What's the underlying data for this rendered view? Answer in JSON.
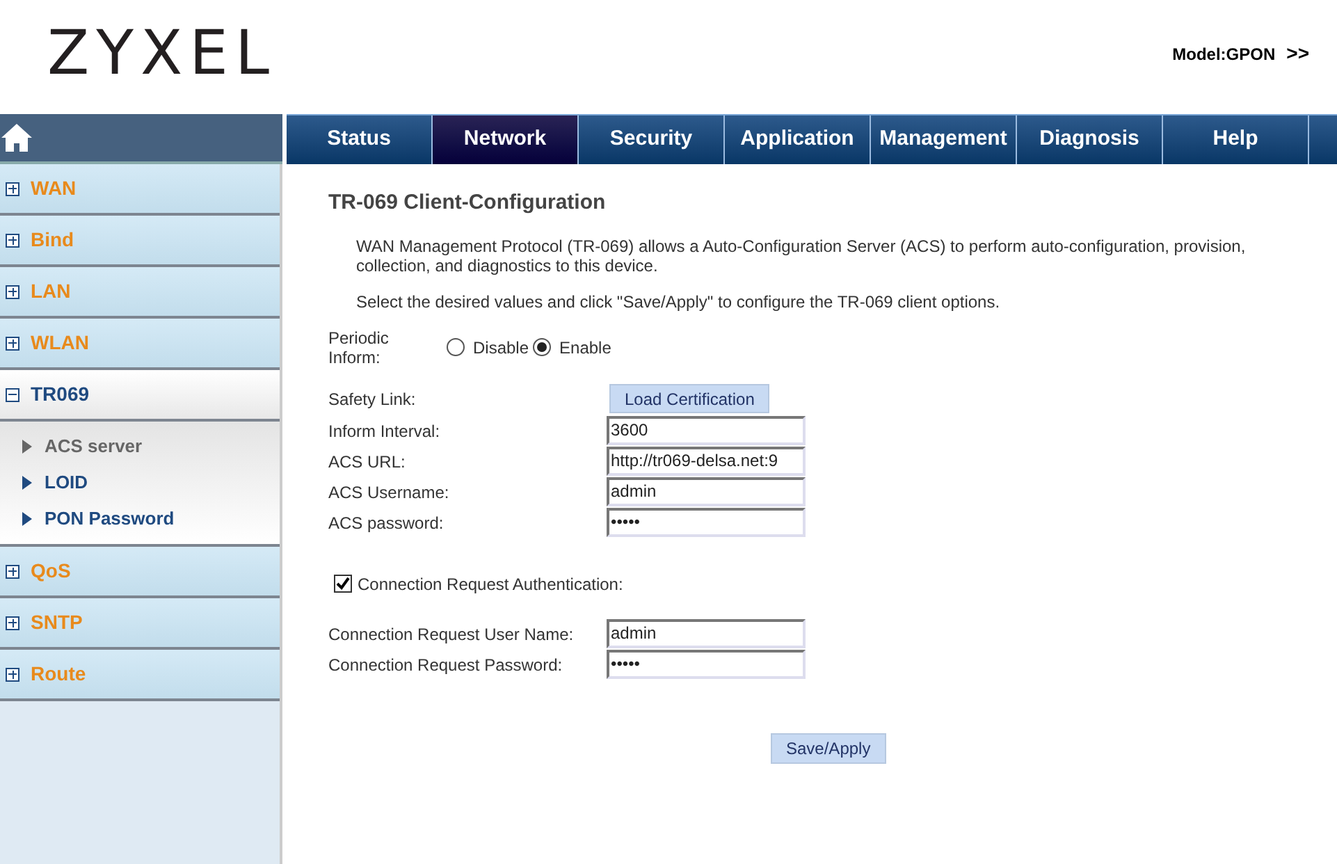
{
  "header": {
    "logo": "ZYXEL",
    "model": "Model:GPON",
    "next": ">>"
  },
  "nav_tabs": [
    {
      "label": "Status",
      "selected": false
    },
    {
      "label": "Network",
      "selected": true
    },
    {
      "label": "Security",
      "selected": false
    },
    {
      "label": "Application",
      "selected": false
    },
    {
      "label": "Management",
      "selected": false
    },
    {
      "label": "Diagnosis",
      "selected": false
    },
    {
      "label": "Help",
      "selected": false
    }
  ],
  "sidebar": {
    "items": [
      {
        "label": "WAN",
        "expanded": false
      },
      {
        "label": "Bind",
        "expanded": false
      },
      {
        "label": "LAN",
        "expanded": false
      },
      {
        "label": "WLAN",
        "expanded": false
      },
      {
        "label": "TR069",
        "expanded": true,
        "children": [
          {
            "label": "ACS server",
            "selected": true
          },
          {
            "label": "LOID",
            "selected": false
          },
          {
            "label": "PON Password",
            "selected": false
          }
        ]
      },
      {
        "label": "QoS",
        "expanded": false
      },
      {
        "label": "SNTP",
        "expanded": false
      },
      {
        "label": "Route",
        "expanded": false
      }
    ]
  },
  "page": {
    "title": "TR-069 Client-Configuration",
    "paragraphs": [
      "WAN Management Protocol (TR-069) allows a Auto-Configuration Server (ACS) to perform auto-configuration, provision, collection, and diagnostics to this device.",
      "Select the desired values and click \"Save/Apply\" to configure the TR-069 client options."
    ],
    "periodic_inform": {
      "label": "Periodic Inform:",
      "options": [
        {
          "label": "Disable",
          "selected": false
        },
        {
          "label": "Enable",
          "selected": true
        }
      ]
    },
    "safety_link": {
      "label": "Safety Link:",
      "button": "Load Certification"
    },
    "fields": [
      {
        "label": "Inform Interval:",
        "value": "3600"
      },
      {
        "label": "ACS URL:",
        "value": "http://tr069-delsa.net:9"
      },
      {
        "label": "ACS Username:",
        "value": "admin"
      },
      {
        "label": "ACS password:",
        "value": "•••••"
      }
    ],
    "connection_auth": {
      "label": "Connection Request Authentication:",
      "checked": true
    },
    "auth_fields": [
      {
        "label": "Connection Request User Name:",
        "value": "admin"
      },
      {
        "label": "Connection Request Password:",
        "value": "•••••"
      }
    ],
    "save_button": "Save/Apply"
  }
}
